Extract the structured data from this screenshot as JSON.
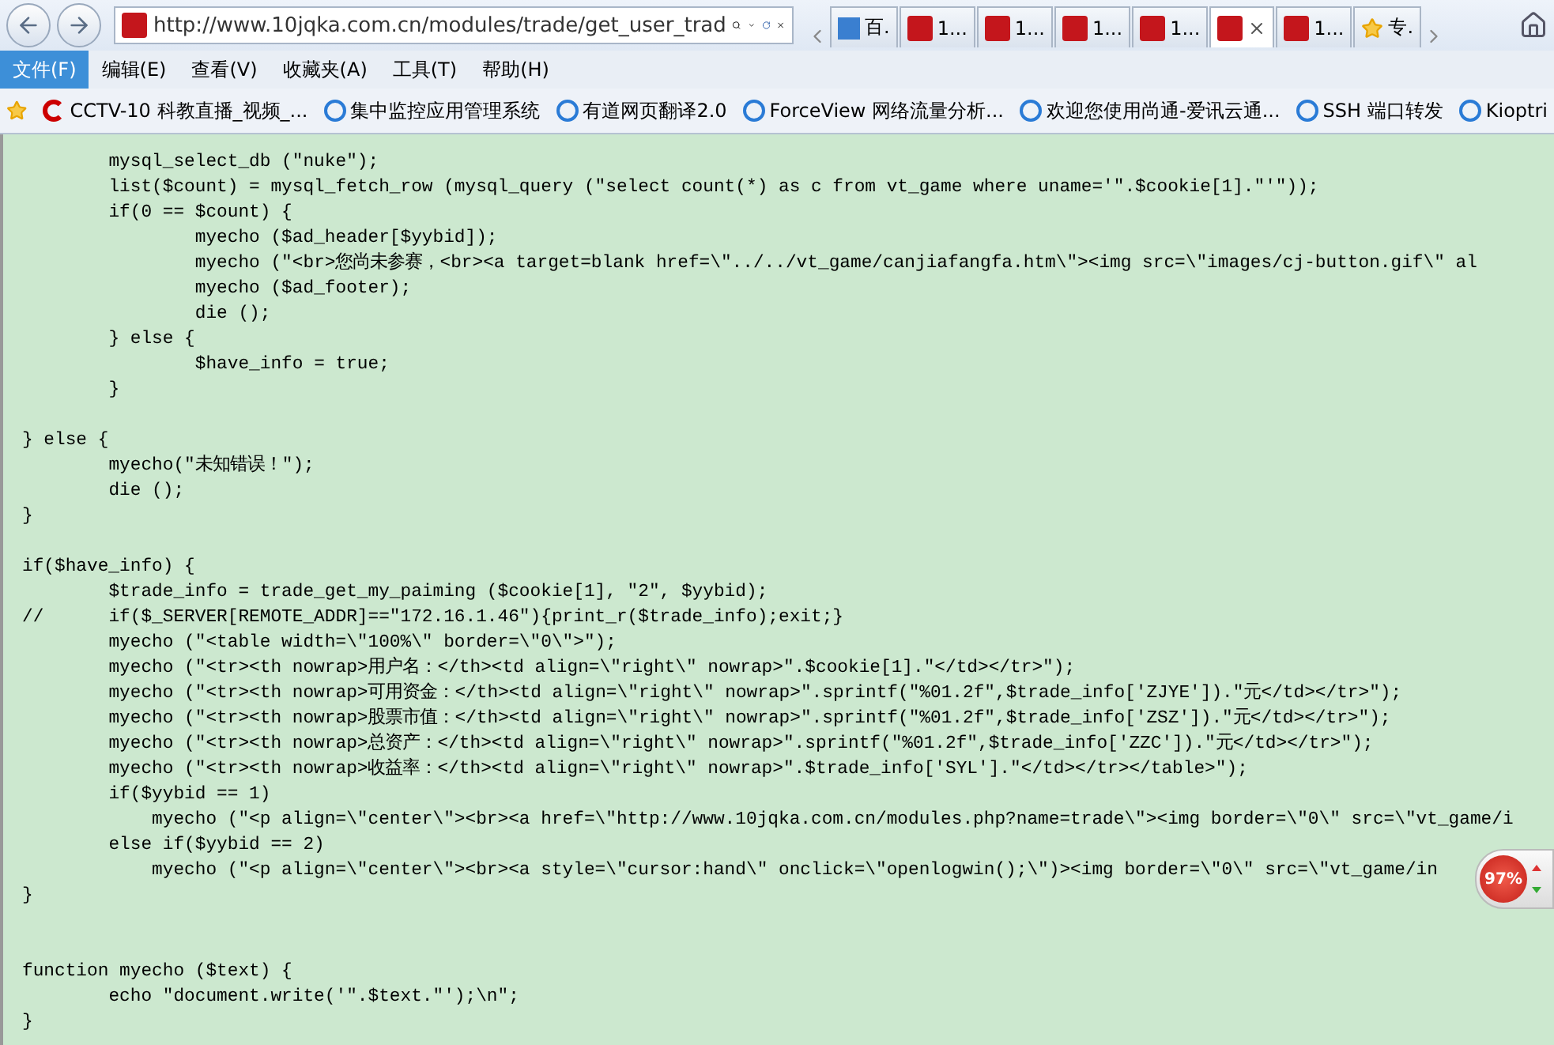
{
  "address": {
    "url": "http://www.10jqka.com.cn/modules/trade/get_user_trad"
  },
  "tabs": [
    {
      "label": "百.",
      "kind": "translate",
      "selected": false
    },
    {
      "label": "1...",
      "kind": "site",
      "selected": false
    },
    {
      "label": "1...",
      "kind": "site",
      "selected": false
    },
    {
      "label": "1...",
      "kind": "site",
      "selected": false
    },
    {
      "label": "1...",
      "kind": "site",
      "selected": false
    },
    {
      "kind": "site",
      "selected": true
    },
    {
      "label": "1...",
      "kind": "site",
      "selected": false
    },
    {
      "label": "专.",
      "kind": "star",
      "selected": false
    }
  ],
  "menu": [
    {
      "label": "文件(F)",
      "selected": true
    },
    {
      "label": "编辑(E)",
      "selected": false
    },
    {
      "label": "查看(V)",
      "selected": false
    },
    {
      "label": "收藏夹(A)",
      "selected": false
    },
    {
      "label": "工具(T)",
      "selected": false
    },
    {
      "label": "帮助(H)",
      "selected": false
    }
  ],
  "favorites": [
    {
      "label": "CCTV-10 科教直播_视频_...",
      "kind": "channel"
    },
    {
      "label": "集中监控应用管理系统",
      "kind": "page"
    },
    {
      "label": "有道网页翻译2.0",
      "kind": "page"
    },
    {
      "label": "ForceView 网络流量分析...",
      "kind": "page"
    },
    {
      "label": "欢迎您使用尚通-爱讯云通...",
      "kind": "page"
    },
    {
      "label": "SSH 端口转发",
      "kind": "page"
    },
    {
      "label": "Kioptri",
      "kind": "page"
    }
  ],
  "code": [
    {
      "kind": "line",
      "text": "\tmysql_select_db (\"nuke\");"
    },
    {
      "kind": "line",
      "text": "\tlist($count) = mysql_fetch_row (mysql_query (\"select count(*) as c from vt_game where uname='\".$cookie[1].\"'\"));"
    },
    {
      "kind": "line",
      "text": "\tif(0 == $count) {"
    },
    {
      "kind": "line",
      "text": "\t\tmyecho ($ad_header[$yybid]);"
    },
    {
      "kind": "line",
      "text": "\t\tmyecho (\"<br>您尚未参赛，<br><a target=blank href=\\\"../../vt_game/canjiafangfa.htm\\\"><img src=\\\"images/cj-button.gif\\\" al"
    },
    {
      "kind": "line",
      "text": "\t\tmyecho ($ad_footer);"
    },
    {
      "kind": "line",
      "text": "\t\tdie ();"
    },
    {
      "kind": "line",
      "text": "\t} else {"
    },
    {
      "kind": "line",
      "text": "\t\t$have_info = true;"
    },
    {
      "kind": "line",
      "text": "\t}"
    },
    {
      "kind": "blank"
    },
    {
      "kind": "line",
      "text": "} else {"
    },
    {
      "kind": "line",
      "text": "\tmyecho(\"未知错误！\");"
    },
    {
      "kind": "line",
      "text": "\tdie ();"
    },
    {
      "kind": "line",
      "text": "}"
    },
    {
      "kind": "blank"
    },
    {
      "kind": "line",
      "text": "if($have_info) {"
    },
    {
      "kind": "line",
      "text": "\t$trade_info = trade_get_my_paiming ($cookie[1], \"2\", $yybid);"
    },
    {
      "kind": "line",
      "text": "//\tif($_SERVER[REMOTE_ADDR]==\"172.16.1.46\"){print_r($trade_info);exit;}"
    },
    {
      "kind": "line",
      "text": "\tmyecho (\"<table width=\\\"100%\\\" border=\\\"0\\\">\");"
    },
    {
      "kind": "line",
      "text": "\tmyecho (\"<tr><th nowrap>用户名：</th><td align=\\\"right\\\" nowrap>\".$cookie[1].\"</td></tr>\");"
    },
    {
      "kind": "line",
      "text": "\tmyecho (\"<tr><th nowrap>可用资金：</th><td align=\\\"right\\\" nowrap>\".sprintf(\"%01.2f\",$trade_info['ZJYE']).\"元</td></tr>\");"
    },
    {
      "kind": "line",
      "text": "\tmyecho (\"<tr><th nowrap>股票市值：</th><td align=\\\"right\\\" nowrap>\".sprintf(\"%01.2f\",$trade_info['ZSZ']).\"元</td></tr>\");"
    },
    {
      "kind": "line",
      "text": "\tmyecho (\"<tr><th nowrap>总资产：</th><td align=\\\"right\\\" nowrap>\".sprintf(\"%01.2f\",$trade_info['ZZC']).\"元</td></tr>\");"
    },
    {
      "kind": "line",
      "text": "\tmyecho (\"<tr><th nowrap>收益率：</th><td align=\\\"right\\\" nowrap>\".$trade_info['SYL'].\"</td></tr></table>\");"
    },
    {
      "kind": "line",
      "text": "\tif($yybid == 1)"
    },
    {
      "kind": "line",
      "text": "\t    myecho (\"<p align=\\\"center\\\"><br><a href=\\\"http://www.10jqka.com.cn/modules.php?name=trade\\\"><img border=\\\"0\\\" src=\\\"vt_game/i"
    },
    {
      "kind": "line",
      "text": "\telse if($yybid == 2)"
    },
    {
      "kind": "line",
      "text": "\t    myecho (\"<p align=\\\"center\\\"><br><a style=\\\"cursor:hand\\\" onclick=\\\"openlogwin();\\\")><img border=\\\"0\\\" src=\\\"vt_game/in"
    },
    {
      "kind": "line",
      "text": "}"
    },
    {
      "kind": "blank"
    },
    {
      "kind": "blank"
    },
    {
      "kind": "line",
      "text": "function myecho ($text) {"
    },
    {
      "kind": "line",
      "text": "\techo \"document.write('\".$text.\"');\\n\";"
    },
    {
      "kind": "line",
      "text": "}"
    }
  ],
  "widget": {
    "reading": "97%"
  }
}
